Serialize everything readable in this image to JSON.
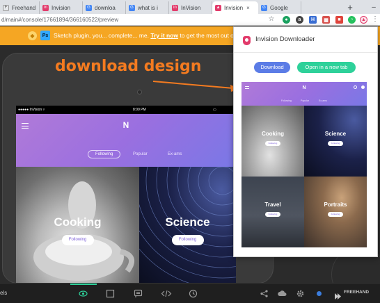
{
  "browser": {
    "tabs": [
      {
        "label": "Freehand",
        "icon": "F",
        "color": "#e8eaed"
      },
      {
        "label": "Invision",
        "icon": "in",
        "color": "#e23b6b"
      },
      {
        "label": "downloa",
        "icon": "G",
        "color": "#4285f4"
      },
      {
        "label": "what is i",
        "icon": "G",
        "color": "#4285f4"
      },
      {
        "label": "InVision",
        "icon": "in",
        "color": "#e23b6b"
      },
      {
        "label": "Invision",
        "icon": "▲",
        "color": "#e23b6b"
      },
      {
        "label": "Google",
        "icon": "G",
        "color": "#4285f4"
      }
    ],
    "tab_close": "×",
    "new_tab": "+",
    "window_min": "–",
    "url": "d/main#/console/17661894/366160522/preview",
    "star": "☆",
    "menu": "⋮",
    "extensions": [
      {
        "name": "circle-green-extension",
        "glyph": "●",
        "color": "#1aa260"
      },
      {
        "name": "a-extension",
        "glyph": "a",
        "color": "#444444"
      },
      {
        "name": "h-extension",
        "glyph": "H",
        "color": "#3b6fd4"
      },
      {
        "name": "grid-extension",
        "glyph": "▦",
        "color": "#d9534f"
      },
      {
        "name": "red-extension",
        "glyph": "■",
        "color": "#e0453d"
      },
      {
        "name": "chat-extension",
        "glyph": "◔",
        "color": "#25c25e"
      },
      {
        "name": "invision-extension",
        "glyph": "▲",
        "color": "#e23b6b"
      }
    ]
  },
  "banner": {
    "text_before": "Sketch plugin, you... complete... me. ",
    "link": "Try it now",
    "text_after": " to get the most out of I"
  },
  "annotation": "download design",
  "device": {
    "carrier": "●●●●● InVision ▿",
    "time": "8:00 PM",
    "battery": "▭",
    "logo": "N",
    "tabs": [
      "Following",
      "Popular",
      "Ex-ams"
    ],
    "cards": [
      {
        "title": "Cooking",
        "button": "Following"
      },
      {
        "title": "Science",
        "button": "Following"
      }
    ]
  },
  "popup": {
    "title": "Invision Downloader",
    "download_label": "Download",
    "newtab_label": "Open in a new tab",
    "preview": {
      "logo": "N",
      "tabs": [
        "Following",
        "Popular",
        "Ex-ams"
      ],
      "cards": [
        {
          "title": "Cooking",
          "button": "Following"
        },
        {
          "title": "Science",
          "button": "Following"
        },
        {
          "title": "Travel",
          "button": "Following"
        },
        {
          "title": "Portraits",
          "button": "Following"
        }
      ]
    }
  },
  "bottombar": {
    "left_label": "els",
    "brand": "FREEHAND",
    "icons": [
      "eye-icon",
      "comment-box-icon",
      "comment-icon",
      "code-icon",
      "history-icon",
      "share-icon",
      "upload-icon",
      "settings-icon",
      "dot-icon"
    ]
  },
  "colors": {
    "accent_green": "#2ed19a",
    "accent_blue": "#5b7ce6",
    "banner_orange": "#f5a623",
    "annotation_orange": "#f47b20"
  }
}
